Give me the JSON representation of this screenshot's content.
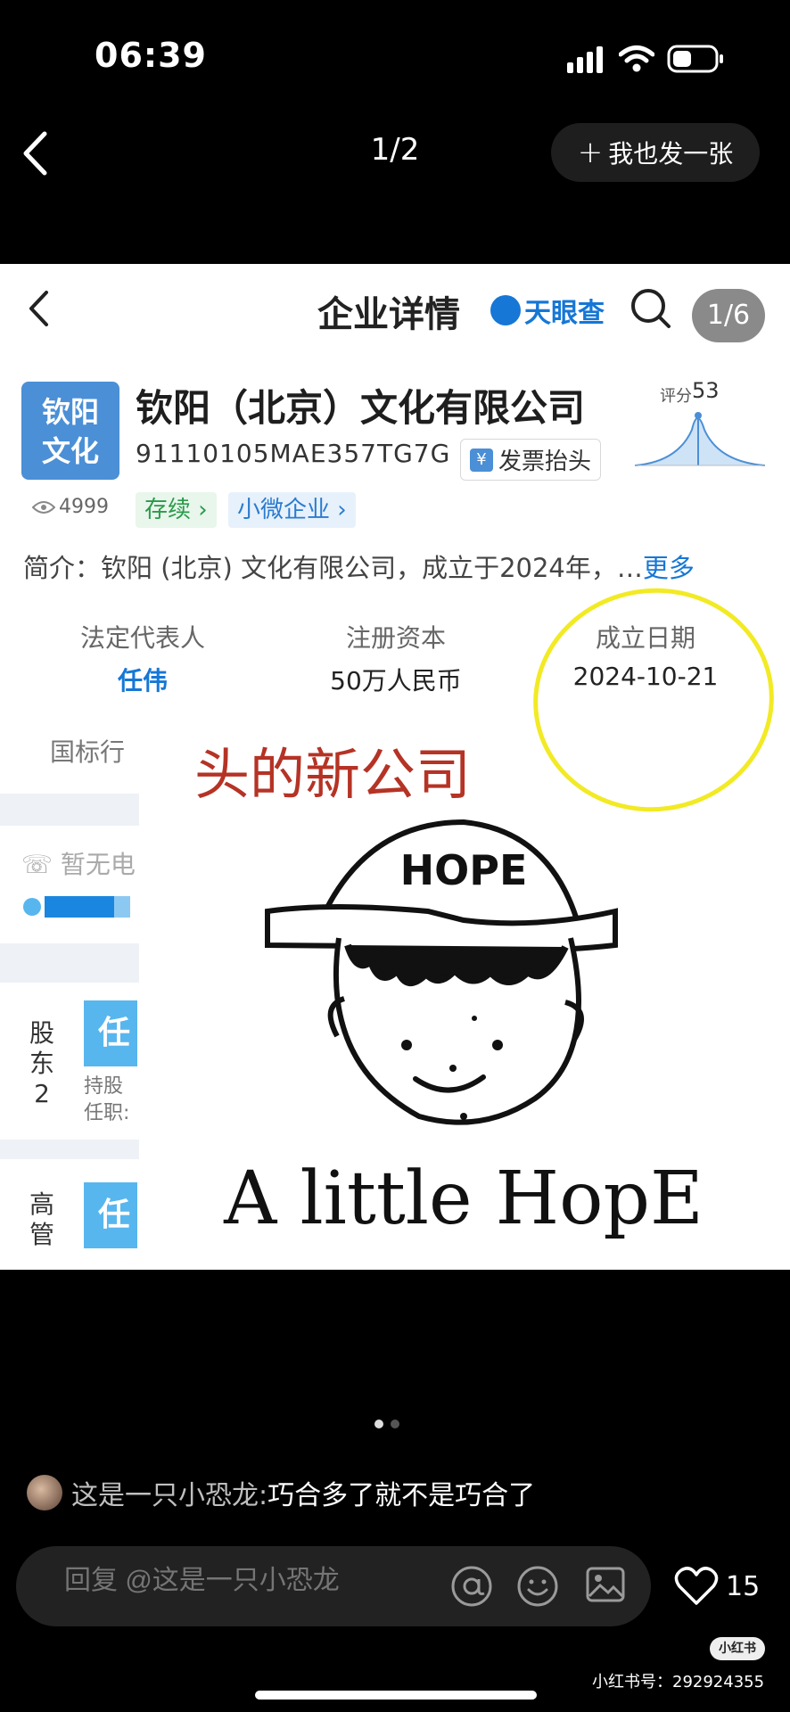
{
  "status_bar": {
    "time": "06:39"
  },
  "nav": {
    "page_counter": "1/2",
    "post_too_label": "我也发一张"
  },
  "screenshot": {
    "header_title": "企业详情",
    "brand": "天眼查",
    "image_counter": "1/6",
    "logo_line1": "钦阳",
    "logo_line2": "文化",
    "company_name": "钦阳（北京）文化有限公司",
    "credit_code": "91110105MAE357TG7G",
    "invoice_label": "发票抬头",
    "score_label": "评分",
    "score_value": "53",
    "views": "4999",
    "tag_active": "存续",
    "tag_size": "小微企业",
    "intro": "简介：钦阳 (北京) 文化有限公司，成立于2024年，…",
    "intro_more": "更多",
    "legal_rep_label": "法定代表人",
    "legal_rep_value": "任伟",
    "capital_label": "注册资本",
    "capital_value": "50万人民币",
    "founded_label": "成立日期",
    "founded_value": "2024-10-21",
    "industry_label": "国标行",
    "phone_text": "暂无电",
    "holder_label": "股东2",
    "holder_tile": "任",
    "holder_sub1": "持股",
    "holder_sub2": "任职:",
    "mgr_label": "高管",
    "mgr_tile": "任",
    "overlay_text": "头的新公司",
    "drawing_cap": "HOPE",
    "drawing_caption": "A little HopE"
  },
  "comment": {
    "user": "这是一只小恐龙:",
    "text": " 巧合多了就不是巧合了"
  },
  "reply": {
    "placeholder": "回复 @这是一只小恐龙"
  },
  "likes": "15",
  "watermark": {
    "badge": "小红书",
    "id": "小红书号：292924355"
  }
}
